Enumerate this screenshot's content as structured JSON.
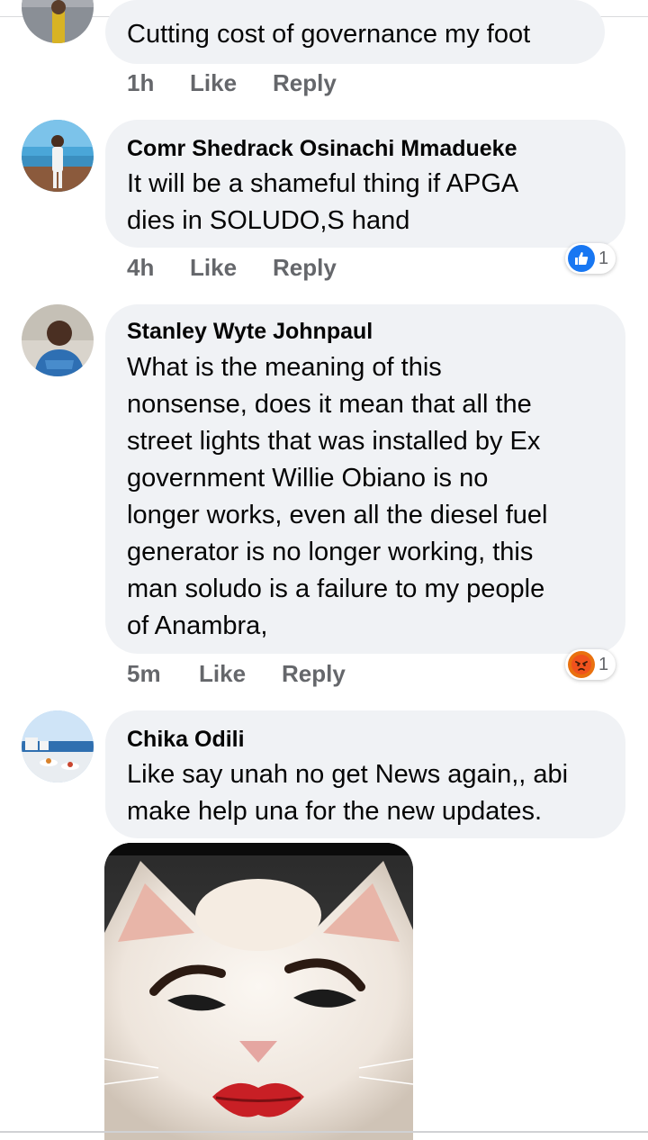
{
  "comments": [
    {
      "text": "Cutting cost of governance my foot",
      "time": "1h",
      "like": "Like",
      "reply": "Reply"
    },
    {
      "author": "Comr Shedrack Osinachi Mmadueke",
      "text": "It will be a shameful thing if APGA\ndies in SOLUDO,S  hand",
      "time": "4h",
      "like": "Like",
      "reply": "Reply",
      "reaction": {
        "icon": "like-reaction-icon",
        "count": "1",
        "color": "#1877f2"
      }
    },
    {
      "author": "Stanley Wyte Johnpaul",
      "text": "What is the meaning of this\nnonsense, does it mean that all the\nstreet lights that was installed by Ex\ngovernment Willie Obiano  is no\nlonger works, even all the diesel fuel\ngenerator is no longer working, this\nman soludo is a failure to my people\nof Anambra,",
      "time": "5m",
      "like": "Like",
      "reply": "Reply",
      "reaction": {
        "icon": "angry-reaction-icon",
        "count": "1",
        "color": "#e9710f"
      }
    },
    {
      "author": "Chika Odili",
      "text": "Like say unah no get News again,, abi\nmake help una for the new updates.",
      "attachment": "cat-with-makeup-image"
    }
  ]
}
